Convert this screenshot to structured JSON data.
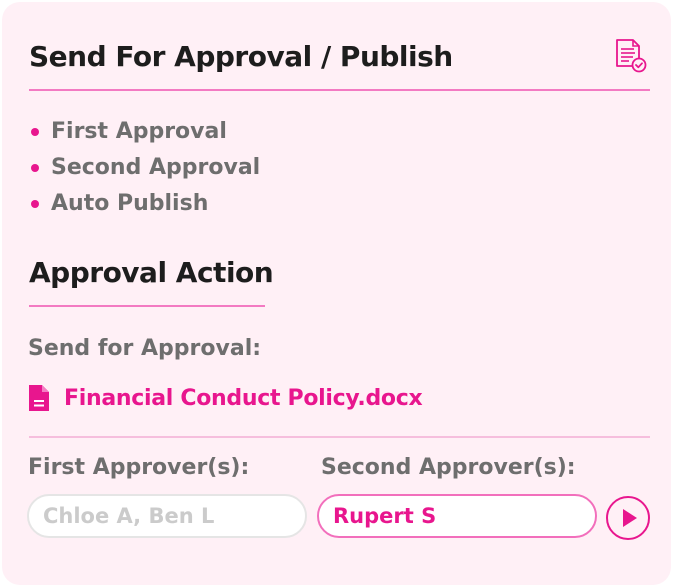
{
  "header": {
    "title": "Send For Approval / Publish",
    "icon": "document-check-icon"
  },
  "steps": [
    {
      "label": "First Approval"
    },
    {
      "label": "Second Approval"
    },
    {
      "label": "Auto Publish"
    }
  ],
  "approval_action": {
    "title": "Approval Action",
    "send_label": "Send for Approval:",
    "file": {
      "name": "Financial Conduct Policy.docx",
      "icon": "document-file-icon"
    },
    "first_approvers": {
      "label": "First Approver(s):",
      "value": "",
      "placeholder": "Chloe A, Ben L"
    },
    "second_approvers": {
      "label": "Second Approver(s):",
      "value": "Rupert S"
    },
    "submit": {
      "icon": "play-icon"
    }
  },
  "colors": {
    "accent": "#e8168e",
    "card_background": "#fff0f6",
    "divider": "#f37ac2",
    "heading": "#1d1d1d",
    "muted_text": "#6e6e6e"
  }
}
